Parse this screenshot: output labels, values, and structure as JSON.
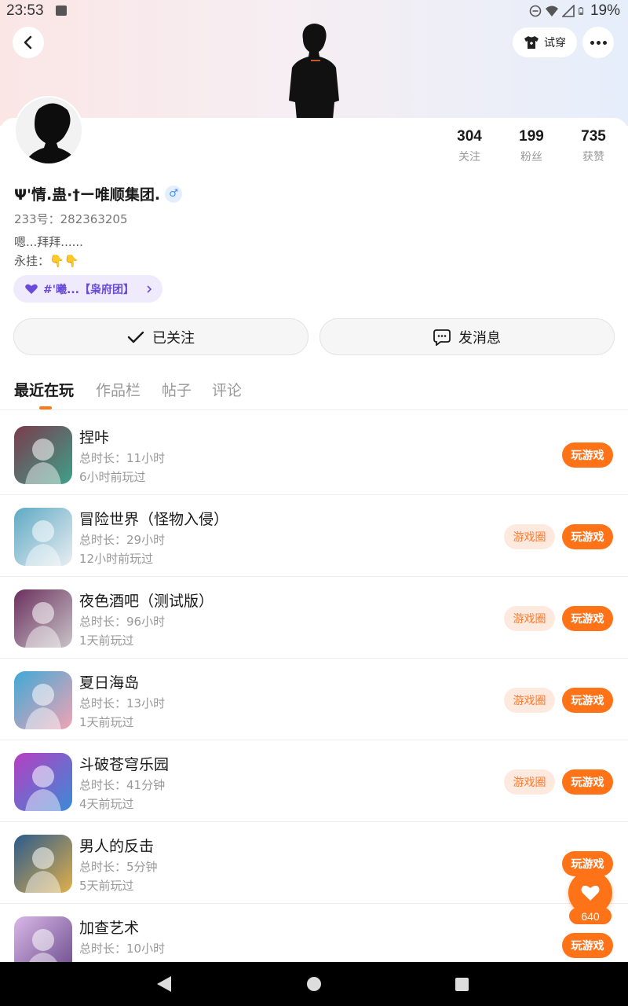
{
  "status_bar": {
    "time": "23:53",
    "battery": "19%"
  },
  "header": {
    "tryon_label": "试穿"
  },
  "profile": {
    "username": "Ψ'情.蛊·†ー唯顺集团.",
    "gender_symbol": "♂",
    "uid": "233号：282363205",
    "bio_line1": "嗯...拜拜......",
    "bio_line2": "永挂：👇👇",
    "tag": "#'曦...【枭府团】",
    "stats": [
      {
        "num": "304",
        "label": "关注"
      },
      {
        "num": "199",
        "label": "粉丝"
      },
      {
        "num": "735",
        "label": "获赞"
      }
    ]
  },
  "actions": {
    "follow_label": "已关注",
    "message_label": "发消息"
  },
  "tabs": [
    "最近在玩",
    "作品栏",
    "帖子",
    "评论"
  ],
  "games": [
    {
      "title": "捏咔",
      "duration": "总时长：11小时",
      "last_played": "6小时前玩过",
      "has_circle": false,
      "icon_colors": [
        "#7a3b4d",
        "#3fa08a"
      ]
    },
    {
      "title": "冒险世界（怪物入侵）",
      "duration": "总时长：29小时",
      "last_played": "12小时前玩过",
      "has_circle": true,
      "icon_colors": [
        "#5ea9c4",
        "#e9eef2"
      ]
    },
    {
      "title": "夜色酒吧（测试版）",
      "duration": "总时长：96小时",
      "last_played": "1天前玩过",
      "has_circle": true,
      "icon_colors": [
        "#6b2f5e",
        "#c9c4c8"
      ]
    },
    {
      "title": "夏日海岛",
      "duration": "总时长：13小时",
      "last_played": "1天前玩过",
      "has_circle": true,
      "icon_colors": [
        "#3fa9d6",
        "#f2a3b4"
      ]
    },
    {
      "title": "斗破苍穹乐园",
      "duration": "总时长：41分钟",
      "last_played": "4天前玩过",
      "has_circle": true,
      "icon_colors": [
        "#b63fc2",
        "#3a8bd6"
      ]
    },
    {
      "title": "男人的反击",
      "duration": "总时长：5分钟",
      "last_played": "5天前玩过",
      "has_circle": false,
      "icon_colors": [
        "#2b5a8c",
        "#e0b04a"
      ]
    },
    {
      "title": "加查艺术",
      "duration": "总时长：10小时",
      "last_played": "",
      "has_circle": false,
      "icon_colors": [
        "#d9b8e8",
        "#6a4a8a"
      ]
    }
  ],
  "buttons": {
    "play_label": "玩游戏",
    "circle_label": "游戏圈"
  },
  "fab": {
    "count": "640"
  }
}
